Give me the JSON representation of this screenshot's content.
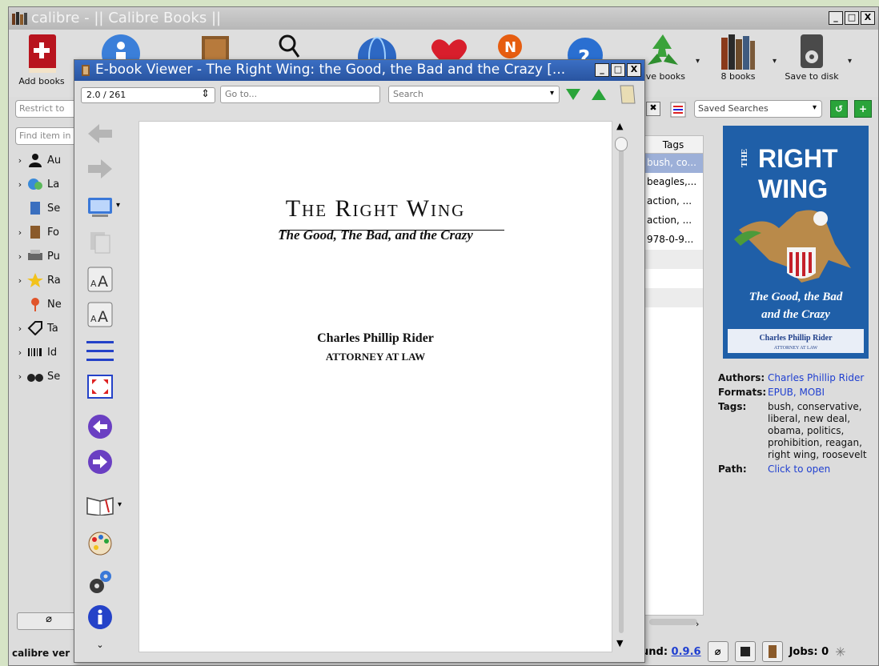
{
  "main_window": {
    "title": "calibre - || Calibre Books ||",
    "window_buttons": [
      "_",
      "□",
      "X"
    ]
  },
  "toolbar": {
    "add_books": "Add books",
    "remove_books": "ove books",
    "library": "8 books",
    "save_to_disk": "Save to disk"
  },
  "search": {
    "restrict_placeholder": "Restrict to",
    "saved_searches": "Saved Searches",
    "find_item_placeholder": "Find item in t"
  },
  "tag_browser": {
    "items": [
      {
        "label": "Au",
        "expandable": true
      },
      {
        "label": "La",
        "expandable": true
      },
      {
        "label": "Se",
        "expandable": false
      },
      {
        "label": "Fo",
        "expandable": true
      },
      {
        "label": "Pu",
        "expandable": true
      },
      {
        "label": "Ra",
        "expandable": true
      },
      {
        "label": "Ne",
        "expandable": false
      },
      {
        "label": "Ta",
        "expandable": true
      },
      {
        "label": "Id",
        "expandable": true
      },
      {
        "label": "Se",
        "expandable": true
      }
    ]
  },
  "book_list": {
    "tags_header": "Tags",
    "tags_cells": [
      "bush, co...",
      "beagles,...",
      "action, ...",
      "action, ...",
      "978-0-9...",
      "",
      "",
      ""
    ]
  },
  "details": {
    "authors_label": "Authors:",
    "authors_value": "Charles Phillip Rider",
    "formats_label": "Formats:",
    "formats_value": "EPUB, MOBI",
    "tags_label": "Tags:",
    "tags_value": "bush, conservative, liberal, new deal, obama, politics, prohibition, reagan, right wing, roosevelt",
    "path_label": "Path:",
    "path_value": "Click to open"
  },
  "cover": {
    "title_line1": "RIGHT",
    "title_the": "THE",
    "title_line2": "WING",
    "subtitle": "The Good, the Bad and the Crazy",
    "author": "Charles Phillip Rider",
    "author_sub": "ATTORNEY AT LAW"
  },
  "status": {
    "left": "calibre ver",
    "update_prefix": "und: ",
    "update_version": "0.9.6",
    "jobs": "Jobs: 0"
  },
  "viewer": {
    "title": "E-book Viewer - The Right Wing: the Good, the Bad and the Crazy [...",
    "position": "2.0 / 261",
    "goto_placeholder": "Go to...",
    "search_placeholder": "Search",
    "page": {
      "title": "The Right Wing",
      "subtitle": "The Good, The Bad, and the Crazy",
      "author": "Charles Phillip Rider",
      "author_title": "ATTORNEY AT LAW"
    }
  },
  "colors": {
    "viewer_titlebar": "#2f5fb0",
    "cover_bg": "#1f5fa8",
    "selected_row": "#9db0d8",
    "link": "#1f3fd0"
  }
}
